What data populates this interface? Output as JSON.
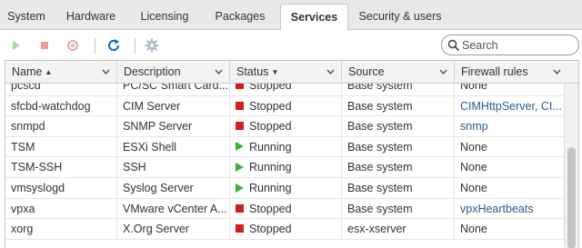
{
  "tabs": [
    {
      "label": "System",
      "active": false
    },
    {
      "label": "Hardware",
      "active": false
    },
    {
      "label": "Licensing",
      "active": false
    },
    {
      "label": "Packages",
      "active": false
    },
    {
      "label": "Services",
      "active": true
    },
    {
      "label": "Security & users",
      "active": false
    }
  ],
  "toolbar": {
    "icons": [
      "play-icon",
      "stop-icon",
      "restart-icon",
      "refresh-icon",
      "settings-gear-icon"
    ],
    "search_placeholder": "Search"
  },
  "table": {
    "columns": [
      {
        "label": "Name",
        "sort": "▲"
      },
      {
        "label": "Description",
        "sort": ""
      },
      {
        "label": "Status",
        "sort": "▼"
      },
      {
        "label": "Source",
        "sort": ""
      },
      {
        "label": "Firewall rules",
        "sort": ""
      }
    ],
    "rows": [
      {
        "name": "pcscd",
        "description": "PC/SC Smart Card...",
        "status": "Stopped",
        "source": "Base system",
        "firewall": "None"
      },
      {
        "name": "sfcbd-watchdog",
        "description": "CIM Server",
        "status": "Stopped",
        "source": "Base system",
        "firewall": "CIMHttpServer, CI..."
      },
      {
        "name": "snmpd",
        "description": "SNMP Server",
        "status": "Stopped",
        "source": "Base system",
        "firewall": "snmp"
      },
      {
        "name": "TSM",
        "description": "ESXi Shell",
        "status": "Running",
        "source": "Base system",
        "firewall": "None"
      },
      {
        "name": "TSM-SSH",
        "description": "SSH",
        "status": "Running",
        "source": "Base system",
        "firewall": "None"
      },
      {
        "name": "vmsyslogd",
        "description": "Syslog Server",
        "status": "Running",
        "source": "Base system",
        "firewall": "None"
      },
      {
        "name": "vpxa",
        "description": "VMware vCenter A...",
        "status": "Stopped",
        "source": "Base system",
        "firewall": "vpxHeartbeats"
      },
      {
        "name": "xorg",
        "description": "X.Org Server",
        "status": "Stopped",
        "source": "esx-xserver",
        "firewall": "None"
      }
    ]
  },
  "colors": {
    "running": "#3bb33b",
    "stopped": "#cc1f1f",
    "link": "#2a5a8c",
    "accent": "#1a73c8"
  }
}
